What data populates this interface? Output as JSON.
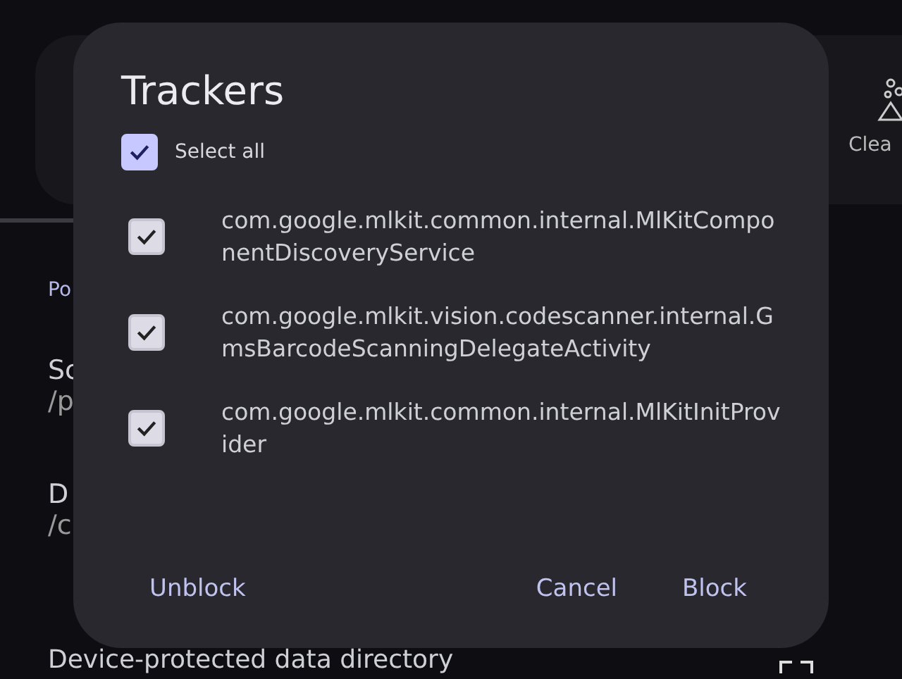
{
  "background": {
    "side_label": "Clea",
    "texts": [
      "Po",
      "Sc",
      "/p",
      "D",
      "/c"
    ],
    "bottom_text": "Device-protected data directory"
  },
  "dialog": {
    "title": "Trackers",
    "select_all": {
      "label": "Select all",
      "checked": true
    },
    "items": [
      {
        "name": "com.google.mlkit.common.internal.MlKitComponentDiscoveryService",
        "checked": true
      },
      {
        "name": "com.google.mlkit.vision.codescanner.internal.GmsBarcodeScanningDelegateActivity",
        "checked": true
      },
      {
        "name": "com.google.mlkit.common.internal.MlKitInitProvider",
        "checked": true
      }
    ],
    "buttons": [
      "Unblock",
      "Cancel",
      "Block"
    ]
  }
}
